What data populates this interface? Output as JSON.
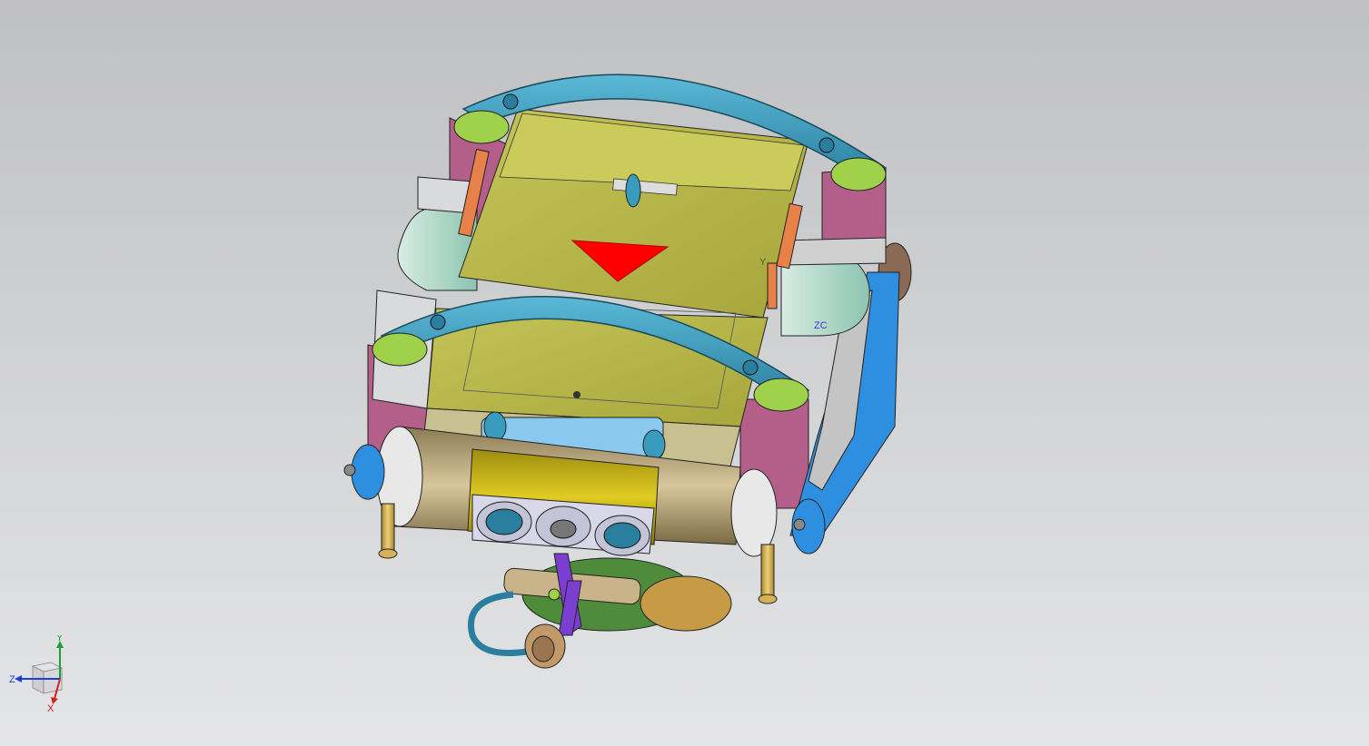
{
  "viewport": {
    "background_top": "#bfc0c2",
    "background_bottom": "#e4e5e7"
  },
  "model": {
    "datum_labels": {
      "wcs_y": "Y",
      "wcs_zc": "ZC"
    },
    "colors": {
      "handle": "#3a9cbc",
      "top_plate": "#b8b845",
      "side_block": "#b35f8a",
      "roller_green": "#9fd14a",
      "pad_mint": "#a9d8c8",
      "blue_rail": "#2e8fe0",
      "drum_tan": "#c8b488",
      "drum_yellow": "#d6c21a",
      "marker_red": "#ff0000",
      "linkage_purple": "#7a3fd0",
      "leg_gold": "#d4b25a"
    }
  },
  "triad": {
    "y_label": "Y",
    "z_label": "Z",
    "x_label": "X",
    "y_color": "#1f9e3a",
    "z_color": "#1f3fd0",
    "x_color": "#d02020"
  }
}
